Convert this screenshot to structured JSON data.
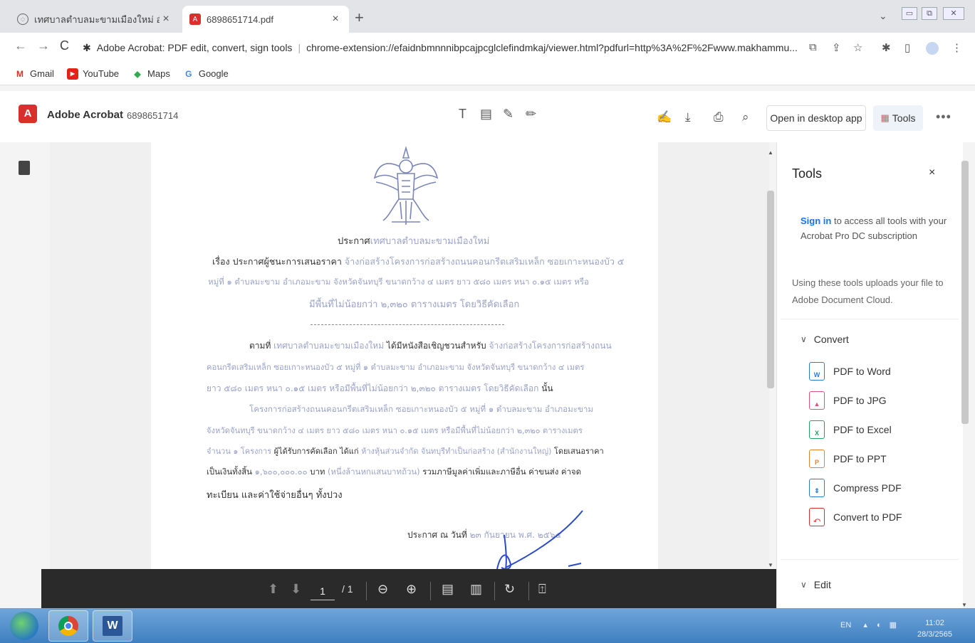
{
  "browser": {
    "tabs": [
      {
        "title": "เทศบาลตำบลมะขามเมืองใหม่ อำเภอเ..",
        "close": "×",
        "active": false
      },
      {
        "title": "6898651714.pdf",
        "close": "×",
        "active": true
      }
    ],
    "new_tab": "+",
    "tab_menu": "⌄",
    "window_controls": [
      "▭",
      "⧉",
      "✕"
    ],
    "nav": {
      "back": "←",
      "forward": "→",
      "reload": "C"
    },
    "omnibox": {
      "extension_name": "Adobe Acrobat: PDF edit, convert, sign tools",
      "separator": "|",
      "url": "chrome-extension://efaidnbmnnnibpcajpcglclefindmkaj/viewer.html?pdfurl=http%3A%2F%2Fwww.makhammu..."
    },
    "bookmarks": [
      {
        "label": "Gmail",
        "icon": "M"
      },
      {
        "label": "YouTube",
        "icon": "▶"
      },
      {
        "label": "Maps",
        "icon": "◆"
      },
      {
        "label": "Google",
        "icon": "G"
      }
    ]
  },
  "acrobat": {
    "app_name": "Adobe Acrobat",
    "file_name": "6898651714",
    "edit_tools": [
      "T",
      "▤",
      "✎",
      "✏"
    ],
    "open_desktop": "Open in desktop app",
    "tools_button": "Tools",
    "more": "•••"
  },
  "document": {
    "lines": [
      {
        "dark": "ประกาศ",
        "faded": "เทศบาลตำบลมะขามเมืองใหม่"
      },
      {
        "dark": "เรื่อง ประกาศผู้ชนะการเสนอราคา ",
        "faded": "จ้างก่อสร้างโครงการก่อสร้างถนนคอนกรีตเสริมเหล็ก ซอยเกาะหนองบัว ๕"
      },
      {
        "dark": "",
        "faded": "หมู่ที่ ๑ ตำบลมะขาม อำเภอมะขาม จังหวัดจันทบุรี ขนาดกว้าง ๔ เมตร ยาว ๕๘๐ เมตร หนา ๐.๑๕ เมตร หรือ"
      },
      {
        "dark": "",
        "faded": "มีพื้นที่ไม่น้อยกว่า ๒,๓๒๐ ตารางเมตร โดยวิธีคัดเลือก"
      },
      {
        "dark": "ตามที่ ",
        "faded": "เทศบาลตำบลมะขามเมืองใหม่",
        "dark2": " ได้มีหนังสือเชิญชวนสำหรับ ",
        "faded2": "จ้างก่อสร้างโครงการก่อสร้างถนน"
      },
      {
        "dark": "",
        "faded": "คอนกรีตเสริมเหล็ก ซอยเกาะหนองบัว ๕ หมู่ที่ ๑ ตำบลมะขาม อำเภอมะขาม จังหวัดจันทบุรี ขนาดกว้าง ๔ เมตร"
      },
      {
        "dark": "",
        "faded": "ยาว ๕๘๐ เมตร หนา ๐.๑๕ เมตร หรือมีพื้นที่ไม่น้อยกว่า ๒,๓๒๐ ตารางเมตร โดยวิธีคัดเลือก",
        "dark2": " นั้น"
      },
      {
        "dark": "",
        "faded": "โครงการก่อสร้างถนนคอนกรีตเสริมเหล็ก ซอยเกาะหนองบัว ๕ หมู่ที่ ๑ ตำบลมะขาม อำเภอมะขาม"
      },
      {
        "dark": "",
        "faded": "จังหวัดจันทบุรี ขนาดกว้าง ๔ เมตร ยาว ๕๘๐ เมตร หนา ๐.๑๕ เมตร หรือมีพื้นที่ไม่น้อยกว่า ๒,๓๒๐ ตารางเมตร"
      },
      {
        "dark": "",
        "faded": "จำนวน ๑ โครงการ",
        "dark2": " ผู้ได้รับการคัดเลือก ได้แก่ ",
        "faded2": "ห้างหุ้นส่วนจำกัด จันทบุรีทำเป็นก่อสร้าง (สำนักงานใหญ่)",
        "dark3": " โดยเสนอราคา"
      },
      {
        "dark": "เป็นเงินทั้งสิ้น ",
        "faded": "๑,๖๐๐,๐๐๐.๐๐",
        "dark2": " บาท ",
        "faded2": "(หนึ่งล้านหกแสนบาทถ้วน)",
        "dark3": " รวมภาษีมูลค่าเพิ่มและภาษีอื่น ค่าขนส่ง ค่าจด"
      },
      {
        "dark": "ทะเบียน และค่าใช้จ่ายอื่นๆ ทั้งปวง",
        "faded": ""
      },
      {
        "dark": "ประกาศ ณ วันที่ ",
        "faded": "๒๓ กันยายน พ.ศ. ๒๕๖๕"
      }
    ]
  },
  "page_controls": {
    "page_current": "1",
    "page_total": "/ 1"
  },
  "tools_panel": {
    "title": "Tools",
    "close": "×",
    "sign_in_link": "Sign in",
    "sign_in_rest": " to access all tools with your Acrobat Pro DC subscription",
    "uploads_note": "Using these tools uploads your file to Adobe Document Cloud.",
    "convert_section": "Convert",
    "items": [
      {
        "label": "PDF to Word",
        "color": "#2b7cd3",
        "abbr": "W"
      },
      {
        "label": "PDF to JPG",
        "color": "#e0527a",
        "abbr": "▲"
      },
      {
        "label": "PDF to Excel",
        "color": "#21a366",
        "abbr": "X"
      },
      {
        "label": "PDF to PPT",
        "color": "#e8822a",
        "abbr": "P"
      },
      {
        "label": "Compress PDF",
        "color": "#2b7cd3",
        "abbr": "⇕"
      },
      {
        "label": "Convert to PDF",
        "color": "#d9302b",
        "abbr": "⤺"
      }
    ],
    "edit_section": "Edit"
  },
  "taskbar": {
    "tray_lang": "EN",
    "time": "11:02",
    "date": "28/3/2565"
  }
}
